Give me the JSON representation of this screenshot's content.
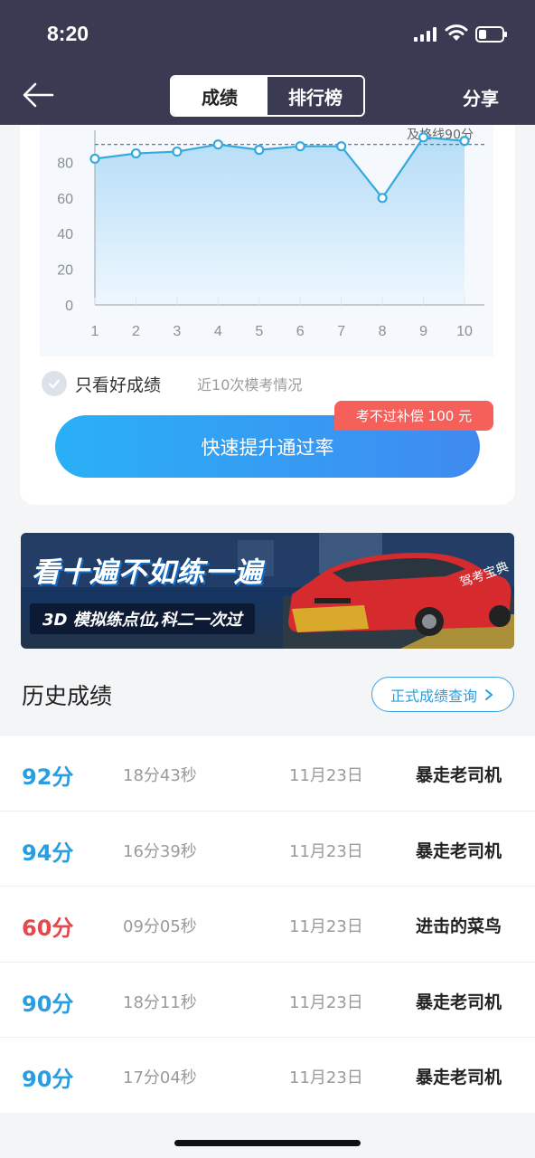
{
  "status": {
    "time": "8:20"
  },
  "nav": {
    "tabs": [
      {
        "label": "成绩",
        "active": true
      },
      {
        "label": "排行榜",
        "active": false
      }
    ],
    "share_label": "分享"
  },
  "chart_data": {
    "type": "area",
    "x": [
      1,
      2,
      3,
      4,
      5,
      6,
      7,
      8,
      9,
      10
    ],
    "series": [
      {
        "values": [
          82,
          85,
          86,
          90,
          87,
          89,
          89,
          60,
          94,
          92
        ]
      }
    ],
    "reference_line": 90,
    "reference_label_partial": "及格线90分",
    "ylim": [
      0,
      100
    ],
    "yticks": [
      0,
      20,
      40,
      60,
      80
    ],
    "color": "#35a9de"
  },
  "filter": {
    "label": "只看好成绩",
    "subtitle": "近10次模考情况"
  },
  "cta": {
    "label": "快速提升通过率",
    "badge": "考不过补偿 100 元"
  },
  "banner": {
    "line1": "看十遍不如练一遍",
    "line2": "3D 模拟练点位,科二一次过",
    "car_text": "驾考宝典"
  },
  "history": {
    "title": "历史成绩",
    "button_label": "正式成绩查询",
    "rows": [
      {
        "score": "92分",
        "duration": "18分43秒",
        "date": "11月23日",
        "level": "暴走老司机",
        "pass": true
      },
      {
        "score": "94分",
        "duration": "16分39秒",
        "date": "11月23日",
        "level": "暴走老司机",
        "pass": true
      },
      {
        "score": "60分",
        "duration": "09分05秒",
        "date": "11月23日",
        "level": "进击的菜鸟",
        "pass": false
      },
      {
        "score": "90分",
        "duration": "18分11秒",
        "date": "11月23日",
        "level": "暴走老司机",
        "pass": true
      },
      {
        "score": "90分",
        "duration": "17分04秒",
        "date": "11月23日",
        "level": "暴走老司机",
        "pass": true
      }
    ]
  },
  "colors": {
    "pass": "#2a9de0",
    "fail": "#e5474b",
    "header": "#3a3b52"
  }
}
